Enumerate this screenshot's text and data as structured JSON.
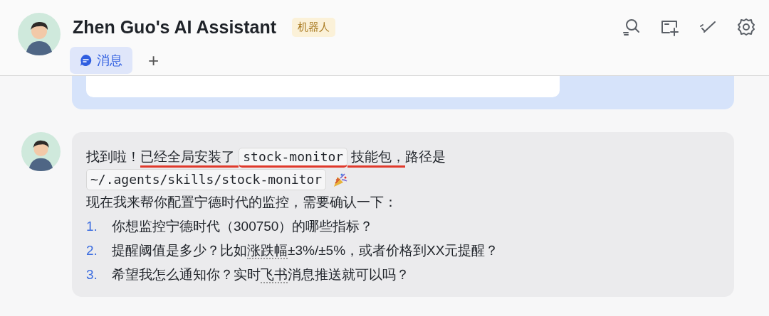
{
  "header": {
    "title": "Zhen Guo's AI Assistant",
    "tag": "机器人",
    "tabs": [
      {
        "label": "消息",
        "selected": true
      }
    ],
    "add_tab": "+"
  },
  "messages": [
    {
      "kind": "card"
    },
    {
      "kind": "reply",
      "intro": [
        {
          "kind": "text",
          "text": "找到啦！",
          "underlined": false
        },
        {
          "kind": "text",
          "text": "已经全局安装了 ",
          "underlined": true
        },
        {
          "kind": "code",
          "text": "stock-monitor",
          "underlined": true
        },
        {
          "kind": "text",
          "text": " 技能包，",
          "underlined": true
        },
        {
          "kind": "text",
          "text": "路径是",
          "underlined": false
        }
      ],
      "path": "~/.agents/skills/stock-monitor",
      "lead": "现在我来帮你配置宁德时代的监控，需要确认一下：",
      "list": [
        {
          "number": "1.",
          "parts": [
            {
              "kind": "text",
              "text": "你想监控宁德时代（300750）的哪些指标？"
            }
          ]
        },
        {
          "number": "2.",
          "parts": [
            {
              "kind": "text",
              "text": "提醒阈值是多少？比如"
            },
            {
              "kind": "term",
              "text": "涨跌幅"
            },
            {
              "kind": "text",
              "text": "±3%/±5%，或者价格到XX元提醒？"
            }
          ]
        },
        {
          "number": "3.",
          "parts": [
            {
              "kind": "text",
              "text": "希望我怎么通知你？实时"
            },
            {
              "kind": "term",
              "text": "飞书"
            },
            {
              "kind": "text",
              "text": "消息推送就可以吗？"
            }
          ]
        }
      ]
    }
  ]
}
